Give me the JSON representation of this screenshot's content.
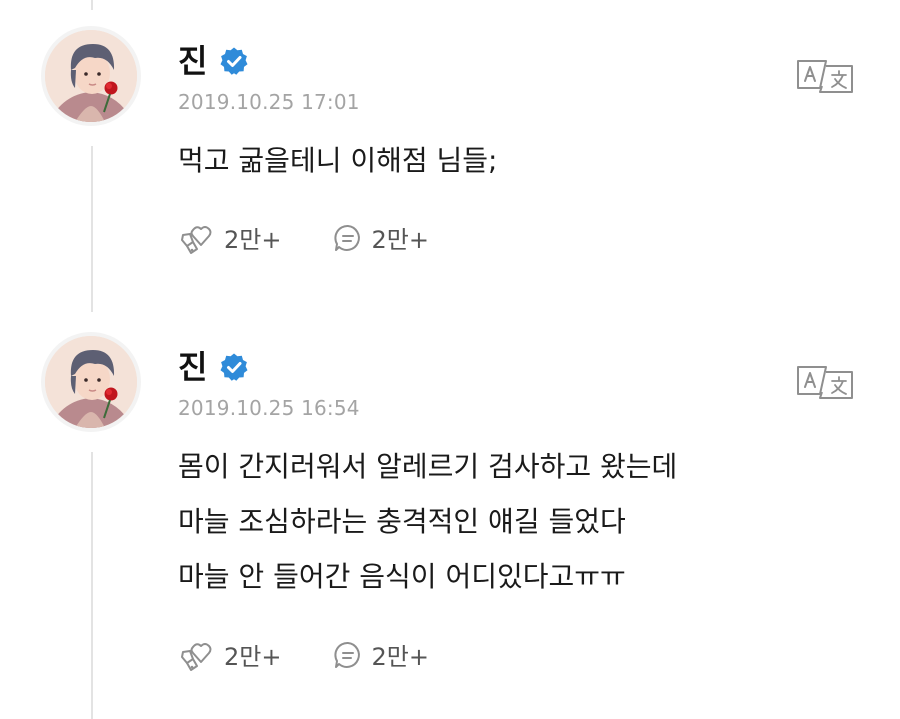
{
  "colors": {
    "verified_badge": "#2f8bd9",
    "timestamp": "#a4a4a4",
    "icon": "#8f8f8f",
    "thread_line": "#e3e3e3"
  },
  "icons": {
    "verified": "verified-badge-icon",
    "translate": "translate-icon",
    "like": "like-icon",
    "comment": "comment-icon"
  },
  "posts": [
    {
      "author": "진",
      "timestamp": "2019.10.25 17:01",
      "body": [
        "먹고 굶을테니 이해점 님들;"
      ],
      "likes": "2만+",
      "comments": "2만+"
    },
    {
      "author": "진",
      "timestamp": "2019.10.25 16:54",
      "body": [
        "몸이 간지러워서 알레르기 검사하고 왔는데",
        "마늘 조심하라는 충격적인 얘길 들었다",
        "마늘 안 들어간 음식이 어디있다고ㅠㅠ"
      ],
      "likes": "2만+",
      "comments": "2만+"
    }
  ]
}
